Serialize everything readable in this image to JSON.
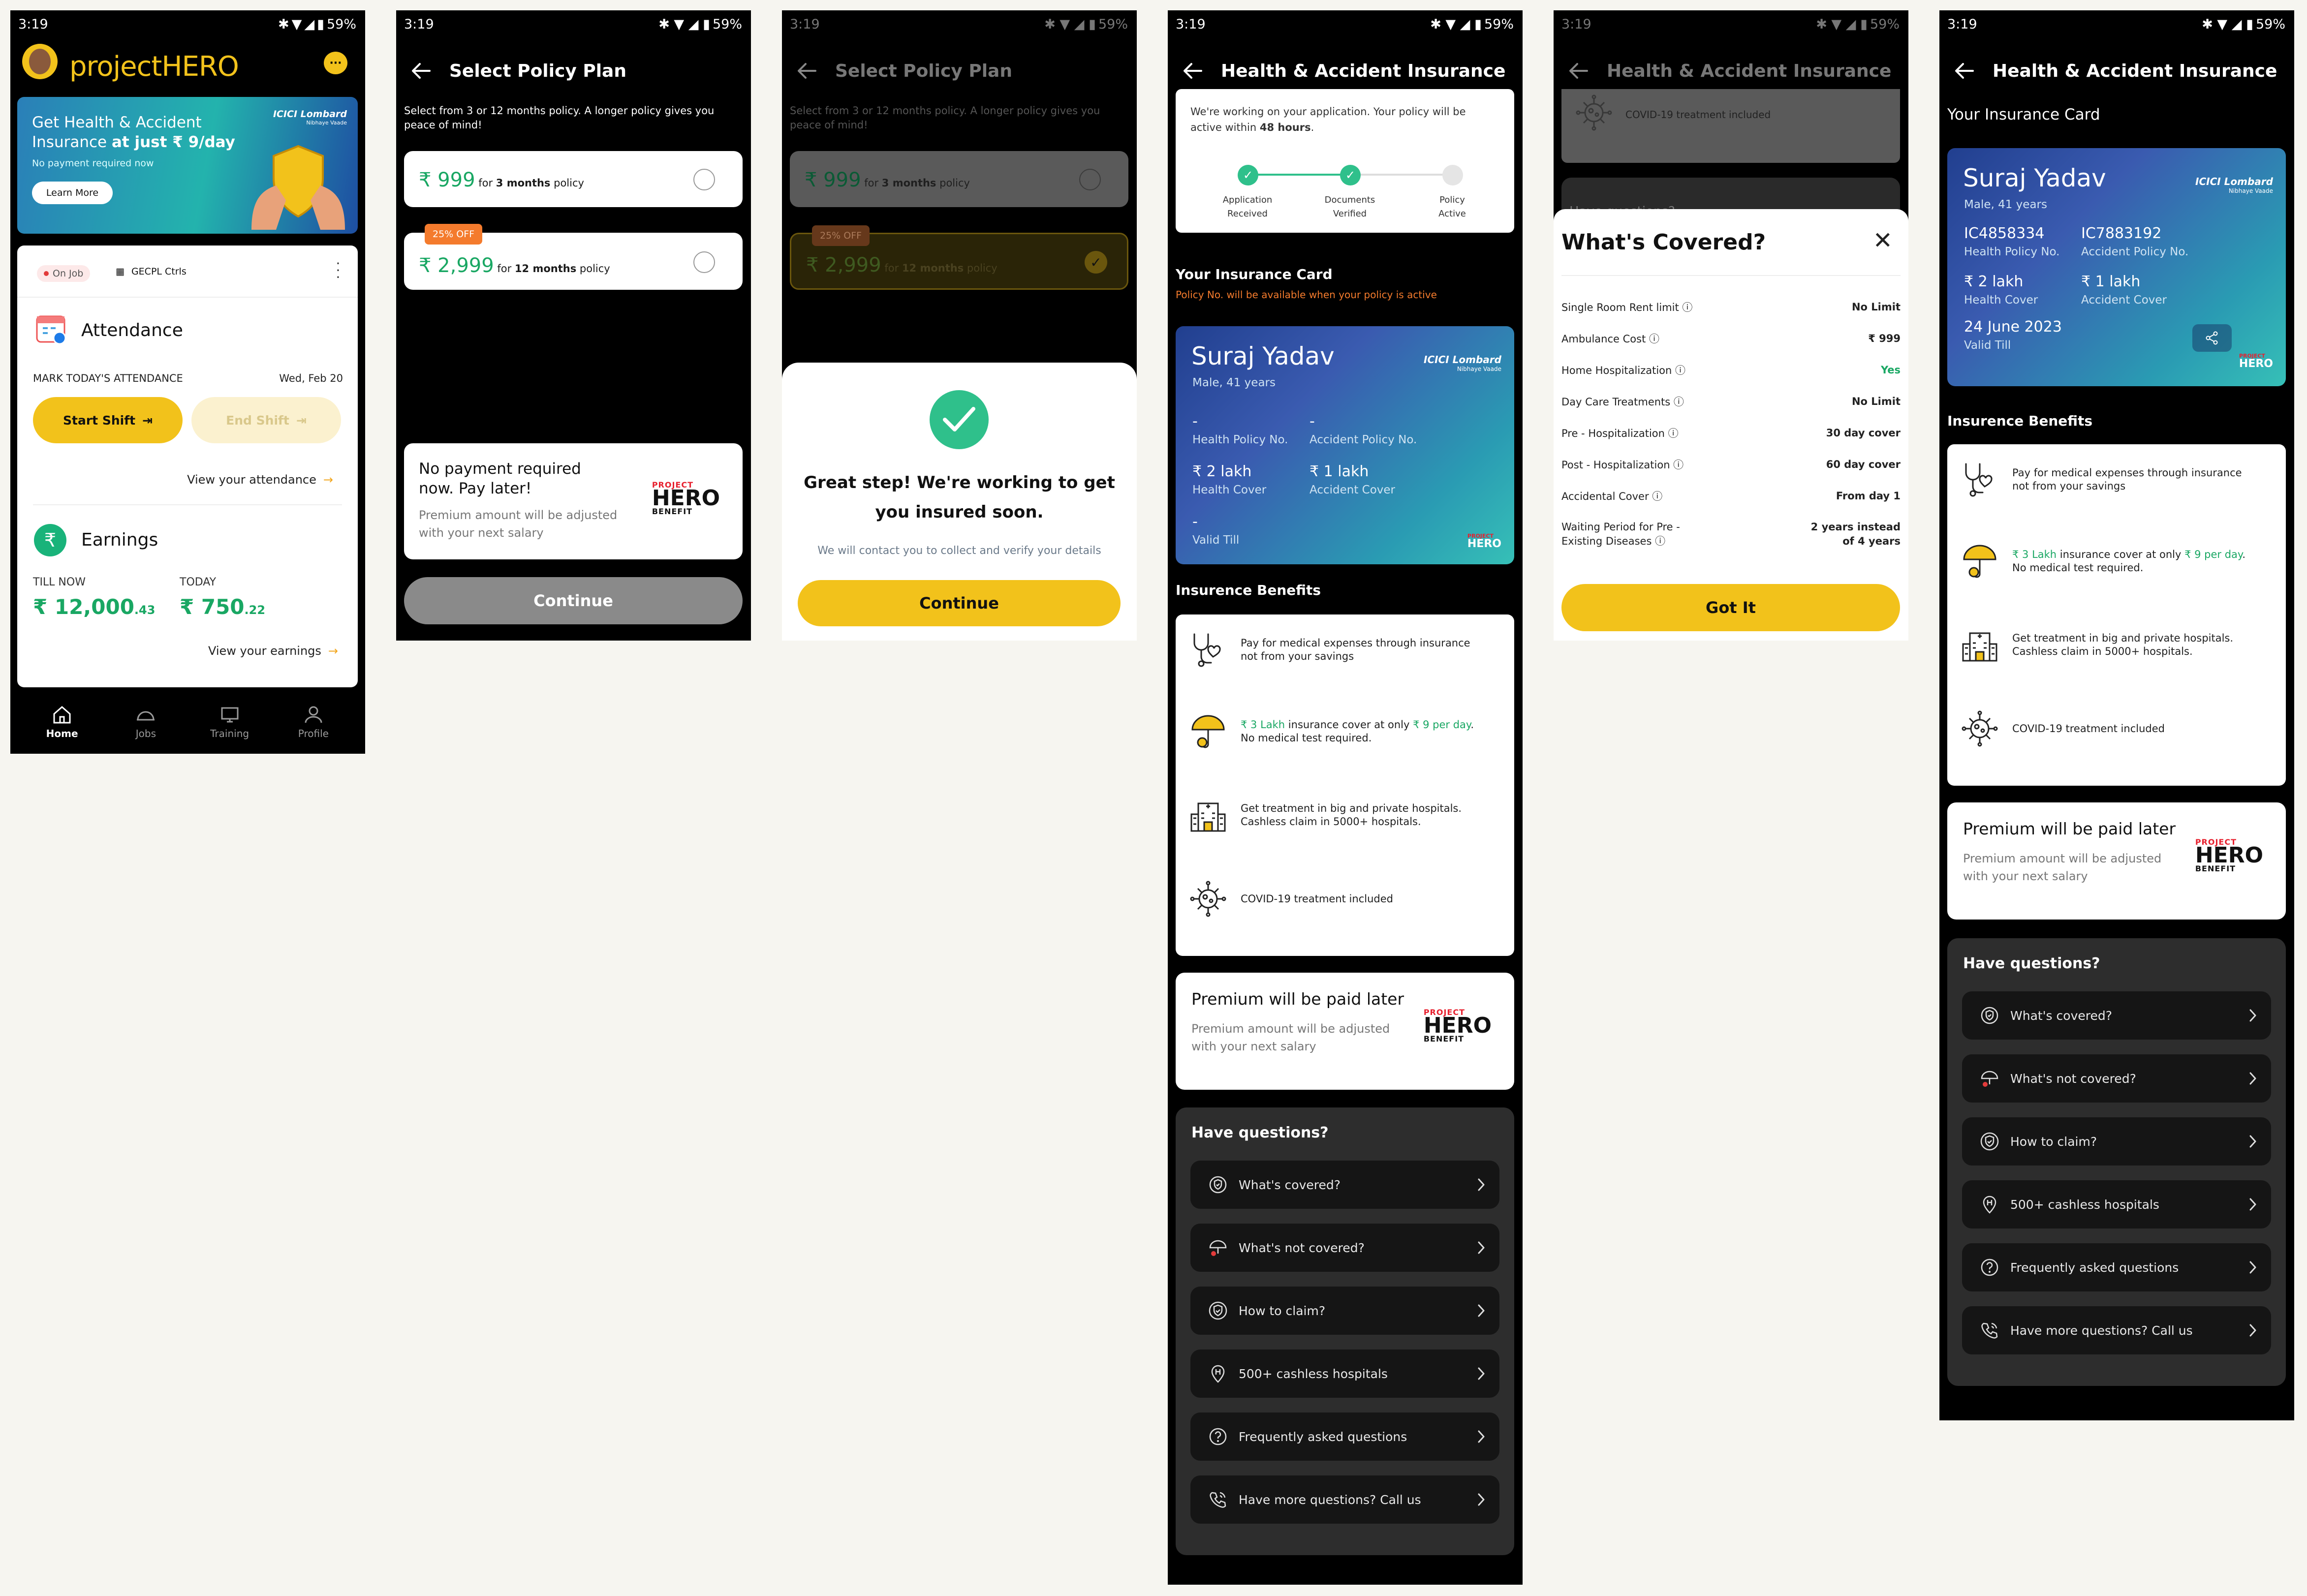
{
  "status_bar": {
    "time": "3:19",
    "battery": "59%"
  },
  "colors": {
    "accent": "#f2c21b",
    "green": "#19a763",
    "orange": "#f47b2d",
    "dark_panel": "#2d2d2d"
  },
  "home": {
    "brand": "projectHERO",
    "banner": {
      "line1": "Get Health & Accident",
      "line2_pre": "Insurance ",
      "line2_bold": "at just ₹ 9/day",
      "sub": "No payment required now",
      "cta": "Learn More",
      "partner": "ICICI Lombard",
      "partner_sub": "Nibhaye Vaade"
    },
    "status_chip": "On Job",
    "company": "GECPL Ctrls",
    "attendance": {
      "title": "Attendance",
      "mark_label": "MARK TODAY'S ATTENDANCE",
      "date": "Wed, Feb 20",
      "start": "Start Shift",
      "end": "End Shift",
      "view": "View your attendance"
    },
    "earnings": {
      "title": "Earnings",
      "till_label": "TILL NOW",
      "till_main": "₹ 12,000",
      "till_dec": ".43",
      "today_label": "TODAY",
      "today_main": "₹ 750",
      "today_dec": ".22",
      "view": "View your earnings"
    },
    "nav": [
      "Home",
      "Jobs",
      "Training",
      "Profile"
    ]
  },
  "policy": {
    "title": "Select Policy Plan",
    "intro": "Select from 3 or 12 months policy. A longer policy gives you peace of mind!",
    "plans": [
      {
        "price": "₹ 999",
        "for": "for ",
        "dur": "3 months",
        "suffix": " policy"
      },
      {
        "price": "₹ 2,999",
        "for": "for ",
        "dur": "12 months",
        "suffix": " policy",
        "badge": "25% OFF"
      }
    ],
    "pay_title_1": "No payment required",
    "pay_title_2": "now. Pay later!",
    "pay_desc_1": "Premium amount will be adjusted",
    "pay_desc_2": "with your next salary",
    "continue": "Continue"
  },
  "hero_badge": {
    "top": "PROJECT",
    "main": "HERO",
    "bottom": "BENEFIT"
  },
  "confirm": {
    "title_1": "Great step! We're working to get",
    "title_2": "you insured soon.",
    "desc": "We will contact you to collect and verify your details",
    "continue": "Continue"
  },
  "insurance": {
    "title": "Health & Accident Insurance",
    "progress_text_1": "We're working on your application. Your policy will be",
    "progress_text_2_pre": "active within ",
    "progress_text_2_bold": "48 hours",
    "progress_text_2_post": ".",
    "steps": [
      {
        "l1": "Application",
        "l2": "Received"
      },
      {
        "l1": "Documents",
        "l2": "Verified"
      },
      {
        "l1": "Policy",
        "l2": "Active"
      }
    ],
    "card_heading": "Your Insurance Card",
    "card_note": "Policy No. will be available when your policy is active",
    "pending_card": {
      "name": "Suraj Yadav",
      "sub": "Male, 41 years",
      "health_no": "-",
      "health_no_label": "Health Policy No.",
      "acc_no": "-",
      "acc_no_label": "Accident Policy No.",
      "health_cover": "₹ 2 lakh",
      "health_cover_label": "Health Cover",
      "acc_cover": "₹ 1 lakh",
      "acc_cover_label": "Accident Cover",
      "valid": "-",
      "valid_label": "Valid Till"
    },
    "benefits_heading": "Insurence Benefits",
    "benefits": [
      {
        "icon": "stethoscope-heart-icon",
        "l1": "Pay for medical expenses through insurance",
        "l2": "not from your savings"
      },
      {
        "icon": "umbrella-shield-icon",
        "l1_hl1": "₹ 3 Lakh",
        "l1_mid": " insurance cover at only ",
        "l1_hl2": "₹ 9 per day",
        "l1_end": ".",
        "l2": "No medical test required."
      },
      {
        "icon": "hospital-building-icon",
        "l1": "Get treatment in big and private hospitals.",
        "l2": "Cashless claim in 5000+ hospitals."
      },
      {
        "icon": "virus-icon",
        "l1": "COVID-19 treatment included",
        "l2": ""
      }
    ],
    "premium_title": "Premium will be paid later",
    "premium_desc_1": "Premium amount will be adjusted",
    "premium_desc_2": "with your next salary",
    "questions_heading": "Have questions?",
    "questions": [
      {
        "icon": "covered-shield-icon",
        "label": "What's covered?"
      },
      {
        "icon": "not-covered-umbrella-icon",
        "label": "What's not covered?"
      },
      {
        "icon": "claim-shield-icon",
        "label": "How to claim?"
      },
      {
        "icon": "hospital-pin-icon",
        "label": "500+ cashless hospitals"
      },
      {
        "icon": "question-circle-icon",
        "label": "Frequently asked questions"
      },
      {
        "icon": "phone-call-icon",
        "label": "Have more questions? Call us"
      }
    ]
  },
  "covered": {
    "behind_text": "COVID-19 treatment included",
    "behind_q": "Have questions?",
    "title": "What's Covered?",
    "rows": [
      {
        "k": "Single Room Rent limit",
        "v": "No Limit",
        "green": false
      },
      {
        "k": "Ambulance Cost",
        "v": "₹ 999",
        "green": false
      },
      {
        "k": "Home Hospitalization",
        "v": "Yes",
        "green": true
      },
      {
        "k": "Day Care Treatments",
        "v": "No Limit",
        "green": false
      },
      {
        "k": "Pre - Hospitalization",
        "v": "30 day cover",
        "green": false
      },
      {
        "k": "Post - Hospitalization",
        "v": "60 day cover",
        "green": false
      },
      {
        "k": "Accidental Cover",
        "v": "From day 1",
        "green": false
      },
      {
        "k1": "Waiting Period for Pre -",
        "k2": "Existing Diseases",
        "v1": "2 years instead",
        "v2": "of 4 years",
        "green": false
      }
    ],
    "got_it": "Got It"
  },
  "active": {
    "card_heading": "Your Insurance Card",
    "card": {
      "name": "Suraj Yadav",
      "sub": "Male, 41 years",
      "health_no": "IC4858334",
      "health_no_label": "Health Policy No.",
      "acc_no": "IC7883192",
      "acc_no_label": "Accident Policy No.",
      "health_cover": "₹ 2 lakh",
      "health_cover_label": "Health Cover",
      "acc_cover": "₹ 1 lakh",
      "acc_cover_label": "Accident Cover",
      "valid": "24 June 2023",
      "valid_label": "Valid Till"
    }
  }
}
